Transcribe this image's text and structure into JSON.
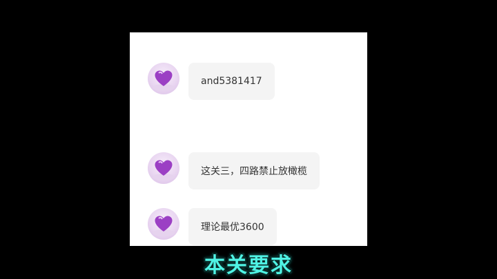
{
  "chat": {
    "messages": [
      {
        "avatar_icon": "purple-heart-icon",
        "text": "and5381417"
      },
      {
        "avatar_icon": "purple-heart-icon",
        "text": "这关三，四路禁止放橄榄"
      },
      {
        "avatar_icon": "purple-heart-icon",
        "text": "理论最优3600"
      }
    ]
  },
  "caption": {
    "text": "本关要求"
  },
  "colors": {
    "background": "#000000",
    "panel": "#ffffff",
    "bubble": "#f4f4f4",
    "caption": "#4ff3e4",
    "heart": "#9b3fc4"
  }
}
